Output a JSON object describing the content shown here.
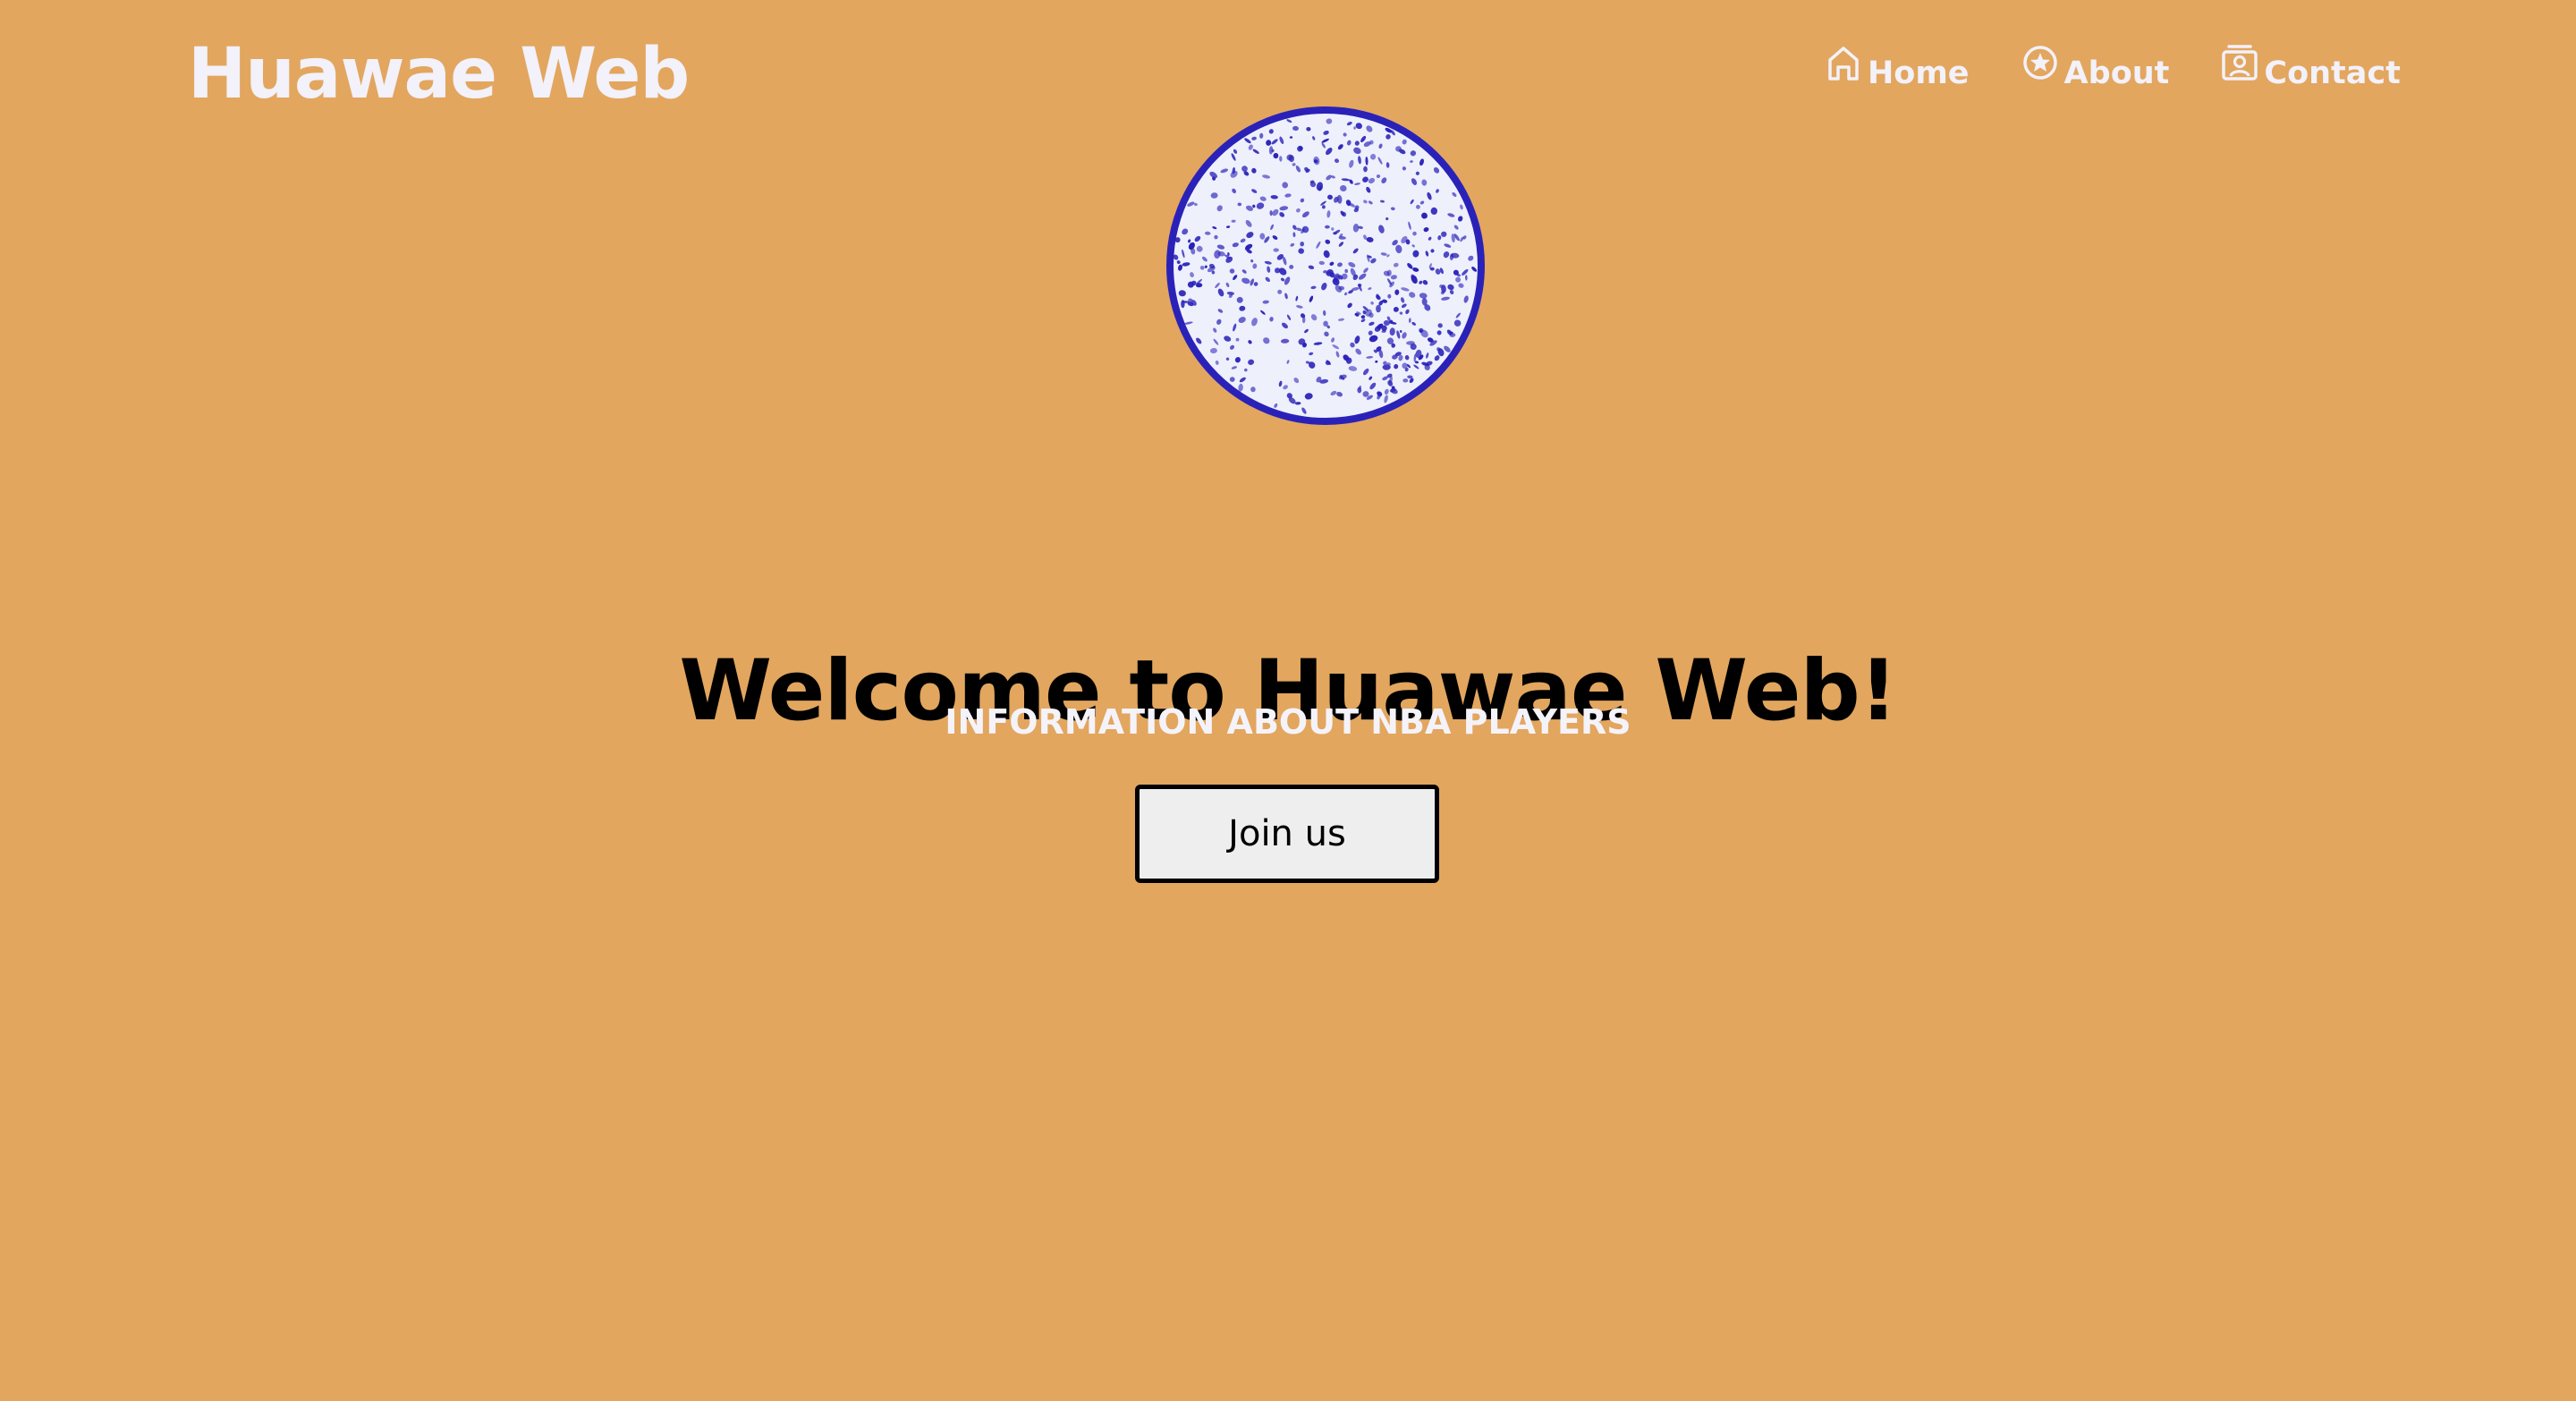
{
  "theme": {
    "background": "#E2A65F",
    "nav_text": "#F3F1F9",
    "brand_text": "#F3F1F9",
    "title_text": "#000000",
    "subtitle_text": "#F5F3FA",
    "button_bg": "#EFEEEF",
    "button_border": "#000000",
    "ball_fill": "#EEF0FC",
    "ball_dots": "#2A22B8"
  },
  "header": {
    "brand": "Huawae Web"
  },
  "nav": {
    "items": [
      {
        "label": "Home",
        "icon": "home-icon"
      },
      {
        "label": "About",
        "icon": "star-circle-icon"
      },
      {
        "label": "Contact",
        "icon": "contact-card-icon"
      }
    ]
  },
  "hero": {
    "image": "basketball-logo",
    "title": "Welcome to Huawae Web!",
    "subtitle": "INFORMATION ABOUT NBA PLAYERS",
    "button_label": "Join us"
  }
}
